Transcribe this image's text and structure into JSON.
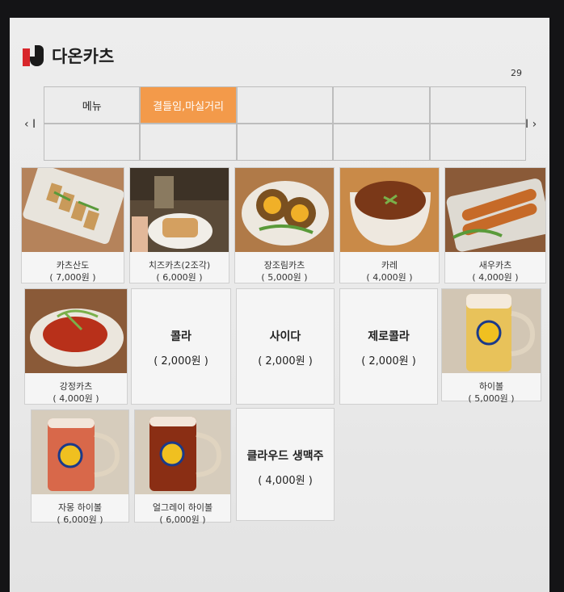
{
  "header": {
    "brand": "다온카츠",
    "page_number": "29"
  },
  "categories": {
    "prev_arrow": "‹ I",
    "next_arrow": "I ›",
    "items": [
      {
        "label": "메뉴",
        "active": false
      },
      {
        "label": "결들임,마실거리",
        "active": true
      },
      {
        "label": "",
        "active": false
      },
      {
        "label": "",
        "active": false
      },
      {
        "label": "",
        "active": false
      },
      {
        "label": "",
        "active": false
      },
      {
        "label": "",
        "active": false
      },
      {
        "label": "",
        "active": false
      },
      {
        "label": "",
        "active": false
      },
      {
        "label": "",
        "active": false
      }
    ]
  },
  "menu": [
    {
      "name": "카츠산도",
      "price": "( 7,000원 )",
      "icon": "katsu-sando-photo"
    },
    {
      "name": "치즈카츠(2조각)",
      "price": "( 6,000원 )",
      "icon": "cheese-katsu-photo"
    },
    {
      "name": "장조림카츠",
      "price": "( 5,000원 )",
      "icon": "jangjorim-katsu-photo"
    },
    {
      "name": "카레",
      "price": "( 4,000원 )",
      "icon": "curry-photo"
    },
    {
      "name": "새우카츠",
      "price": "( 4,000원 )",
      "icon": "shrimp-katsu-photo"
    },
    {
      "name": "강정카츠",
      "price": "( 4,000원 )",
      "icon": "gangjeong-katsu-photo"
    },
    {
      "name": "콜라",
      "price": "( 2,000원 )",
      "icon": ""
    },
    {
      "name": "사이다",
      "price": "( 2,000원 )",
      "icon": ""
    },
    {
      "name": "제로콜라",
      "price": "( 2,000원 )",
      "icon": ""
    },
    {
      "name": "하이볼",
      "price": "( 5,000원 )",
      "icon": "highball-photo"
    },
    {
      "name": "자몽 하이볼",
      "price": "( 6,000원 )",
      "icon": "grapefruit-highball-photo"
    },
    {
      "name": "얼그레이 하이볼",
      "price": "( 6,000원 )",
      "icon": "earl-grey-highball-photo"
    },
    {
      "name": "클라우드 생맥주",
      "price": "( 4,000원 )",
      "icon": ""
    }
  ]
}
